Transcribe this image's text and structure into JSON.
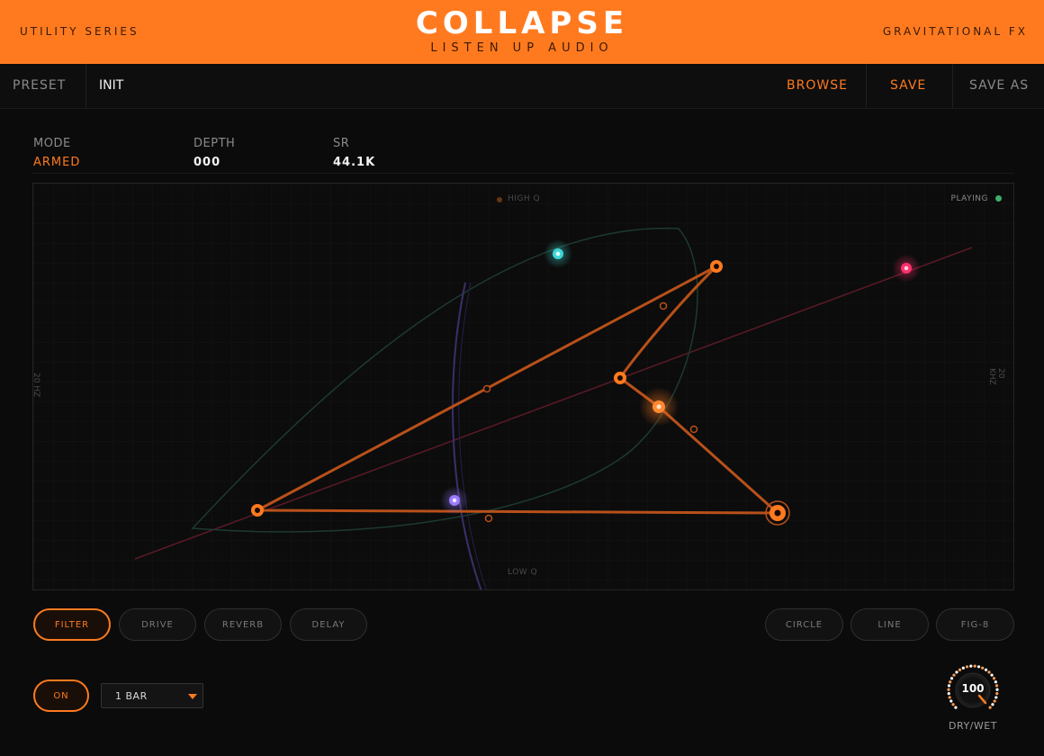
{
  "header": {
    "left": "UTILITY SERIES",
    "title": "COLLAPSE",
    "subtitle": "LISTEN UP AUDIO",
    "right": "GRAVITATIONAL FX"
  },
  "preset": {
    "label": "PRESET",
    "name": "INIT",
    "browse": "BROWSE",
    "save": "SAVE",
    "save_as": "SAVE AS"
  },
  "params": {
    "mode_label": "MODE",
    "mode_value": "ARMED",
    "depth_label": "DEPTH",
    "depth_value": "000",
    "sr_label": "SR",
    "sr_value": "44.1K"
  },
  "canvas": {
    "high_q": "HIGH Q",
    "low_q": "LOW Q",
    "left_axis": "20 HZ",
    "right_axis": "20 KHZ",
    "status": "PLAYING"
  },
  "fx_tabs": [
    "FILTER",
    "DRIVE",
    "REVERB",
    "DELAY"
  ],
  "shape_tabs": [
    "CIRCLE",
    "LINE",
    "FIG-8"
  ],
  "controls": {
    "power": "ON",
    "rate": "1 BAR",
    "knob_value": "100",
    "knob_label": "DRY/WET"
  },
  "colors": {
    "accent": "#ff7a1f",
    "playing": "#3fae6b",
    "cyan": "#3fd6d6",
    "pink": "#ff2f6d",
    "violet": "#9b7bff"
  }
}
